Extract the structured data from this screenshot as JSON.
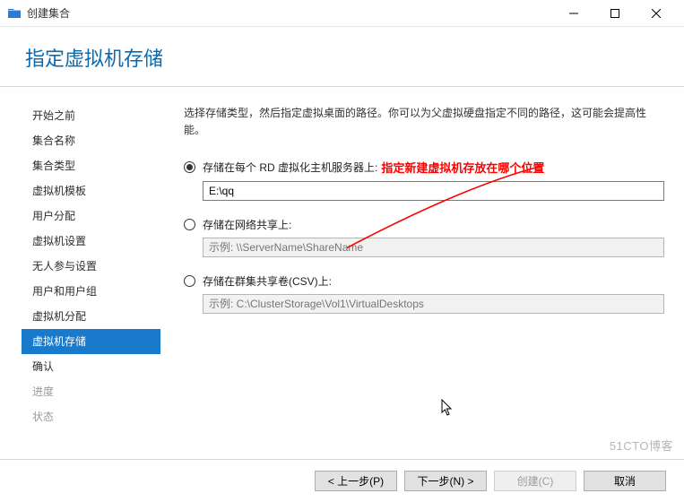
{
  "titlebar": {
    "title": "创建集合"
  },
  "header": {
    "page_title": "指定虚拟机存储"
  },
  "sidebar": {
    "items": [
      {
        "label": "开始之前",
        "state": "normal"
      },
      {
        "label": "集合名称",
        "state": "normal"
      },
      {
        "label": "集合类型",
        "state": "normal"
      },
      {
        "label": "虚拟机模板",
        "state": "normal"
      },
      {
        "label": "用户分配",
        "state": "normal"
      },
      {
        "label": "虚拟机设置",
        "state": "normal"
      },
      {
        "label": "无人参与设置",
        "state": "normal"
      },
      {
        "label": "用户和用户组",
        "state": "normal"
      },
      {
        "label": "虚拟机分配",
        "state": "normal"
      },
      {
        "label": "虚拟机存储",
        "state": "active"
      },
      {
        "label": "确认",
        "state": "normal"
      },
      {
        "label": "进度",
        "state": "disabled"
      },
      {
        "label": "状态",
        "state": "disabled"
      }
    ]
  },
  "content": {
    "description": "选择存储类型，然后指定虚拟桌面的路径。你可以为父虚拟硬盘指定不同的路径，这可能会提高性能。",
    "options": [
      {
        "label": "存储在每个 RD 虚拟化主机服务器上:",
        "checked": true,
        "value": "E:\\qq",
        "placeholder": ""
      },
      {
        "label": "存储在网络共享上:",
        "checked": false,
        "value": "",
        "placeholder": "示例: \\\\ServerName\\ShareName"
      },
      {
        "label": "存储在群集共享卷(CSV)上:",
        "checked": false,
        "value": "",
        "placeholder": "示例: C:\\ClusterStorage\\Vol1\\VirtualDesktops"
      }
    ],
    "annotation": "指定新建虚拟机存放在哪个位置"
  },
  "footer": {
    "prev": "< 上一步(P)",
    "next": "下一步(N) >",
    "create": "创建(C)",
    "cancel": "取消"
  },
  "watermark": "51CTO博客"
}
